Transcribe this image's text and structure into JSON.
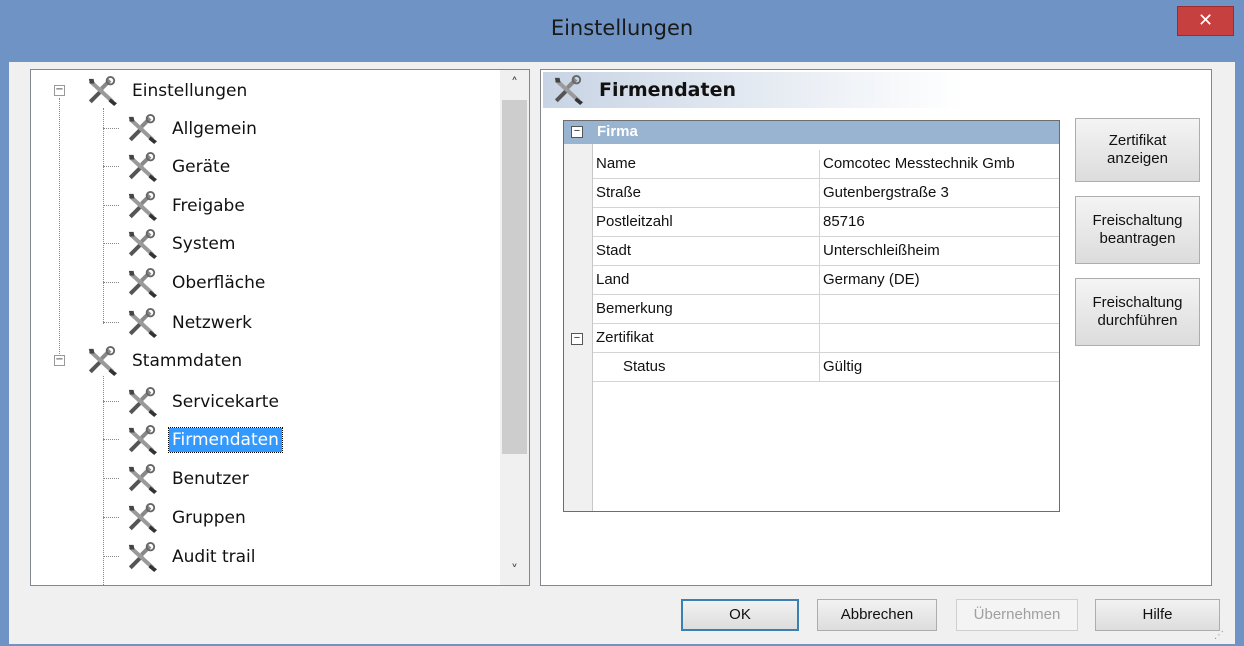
{
  "window": {
    "title": "Einstellungen",
    "close_label": "✕"
  },
  "tree": {
    "groups": [
      {
        "label": "Einstellungen",
        "expander": "−"
      },
      {
        "label": "Stammdaten",
        "expander": "−"
      }
    ],
    "items": [
      {
        "label": "Allgemein"
      },
      {
        "label": "Geräte"
      },
      {
        "label": "Freigabe"
      },
      {
        "label": "System"
      },
      {
        "label": "Oberfläche"
      },
      {
        "label": "Netzwerk"
      },
      {
        "label": "Servicekarte"
      },
      {
        "label": "Firmendaten",
        "selected": true
      },
      {
        "label": "Benutzer"
      },
      {
        "label": "Gruppen"
      },
      {
        "label": "Audit trail"
      }
    ],
    "scroll_up": "˄",
    "scroll_down": "˅"
  },
  "panel": {
    "title": "Firmendaten",
    "category": {
      "label": "Firma",
      "expander": "−"
    },
    "rows": [
      {
        "key": "Name",
        "value": "Comcotec Messtechnik Gmb"
      },
      {
        "key": "Straße",
        "value": "Gutenbergstraße 3"
      },
      {
        "key": "Postleitzahl",
        "value": "85716"
      },
      {
        "key": "Stadt",
        "value": "Unterschleißheim"
      },
      {
        "key": "Land",
        "value": "Germany (DE)"
      },
      {
        "key": "Bemerkung",
        "value": ""
      },
      {
        "key": "Zertifikat",
        "value": "",
        "expander": "−"
      },
      {
        "key": "Status",
        "value": "Gültig"
      }
    ],
    "buttons": [
      {
        "label": "Zertifikat\nanzeigen"
      },
      {
        "label": "Freischaltung\nbeantragen"
      },
      {
        "label": "Freischaltung\ndurchführen"
      }
    ]
  },
  "footer": {
    "ok": "OK",
    "cancel": "Abbrechen",
    "apply": "Übernehmen",
    "help": "Hilfe"
  },
  "colors": {
    "selection": "#3399ff",
    "category_header": "#99b4d1",
    "close": "#c74040"
  }
}
